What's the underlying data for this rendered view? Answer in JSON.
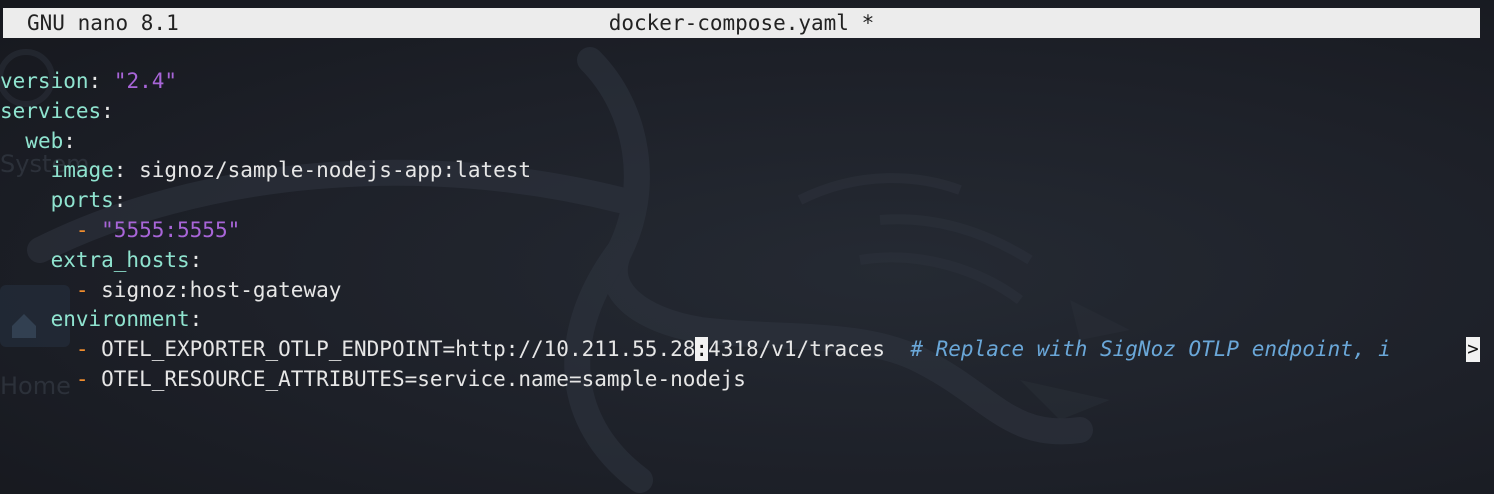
{
  "header": {
    "app_name": "GNU nano 8.1",
    "file_name": "docker-compose.yaml *"
  },
  "editor": {
    "lines": {
      "l0": {
        "indent": "",
        "key": "version",
        "colon": ": ",
        "value": "\"2.4\""
      },
      "l1": {
        "indent": "",
        "key": "services",
        "colon": ":"
      },
      "l2": {
        "indent": "  ",
        "key": "web",
        "colon": ":"
      },
      "l3": {
        "indent": "    ",
        "key": "image",
        "colon": ": ",
        "value": "signoz/sample-nodejs-app:latest"
      },
      "l4": {
        "indent": "    ",
        "key": "ports",
        "colon": ":"
      },
      "l5": {
        "indent": "      ",
        "dash": "- ",
        "value": "\"5555:5555\""
      },
      "l6": {
        "indent": "    ",
        "key": "extra_hosts",
        "colon": ":"
      },
      "l7": {
        "indent": "      ",
        "dash": "- ",
        "value": "signoz:host-gateway"
      },
      "l8": {
        "indent": "    ",
        "key": "environment",
        "colon": ":"
      },
      "l9": {
        "indent": "      ",
        "dash": "- ",
        "value_before_cursor": "OTEL_EXPORTER_OTLP_ENDPOINT=http://10.211.55.28",
        "cursor_char": ":",
        "value_after_cursor": "4318/v1/traces",
        "gap": "  ",
        "comment": "# Replace with SigNoz OTLP endpoint, i",
        "overflow_indicator": ">"
      },
      "l10": {
        "indent": "      ",
        "dash": "- ",
        "value": "OTEL_RESOURCE_ATTRIBUTES=service.name=sample-nodejs"
      }
    }
  },
  "background_faint_text": {
    "system_label": "System",
    "home_label": "Home"
  },
  "colors": {
    "title_bar": "#ececec",
    "key": "#8fe3cf",
    "string": "#a865d8",
    "dash": "#f08d2e",
    "comment": "#6aa7d8",
    "background": "#1d2028"
  }
}
